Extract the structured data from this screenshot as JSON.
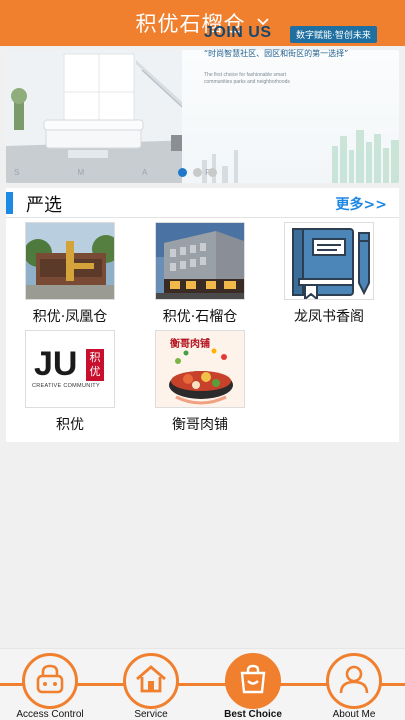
{
  "header": {
    "title": "积优石榴仓"
  },
  "banner": {
    "join_title": "JOIN US",
    "tag": "数字赋能·智创未来",
    "slogan": "“时尚智慧社区、园区和街区的第一选择”",
    "english": "The first choice for fashionable smart communities parks and neighborhoods",
    "watermark": "S M A R",
    "page_count": 3,
    "active_page": 1
  },
  "section": {
    "title": "严选",
    "more": "更多>>",
    "items": [
      {
        "label": "积优·凤凰仓",
        "icon": "building-photo"
      },
      {
        "label": "积优·石榴仓",
        "icon": "building-photo"
      },
      {
        "label": "龙凤书香阁",
        "icon": "book-icon"
      },
      {
        "label": "积优",
        "icon": "ju-logo",
        "logo_text": "JU",
        "logo_sub": "积优",
        "logo_caption": "CREATIVE COMMUNITY"
      },
      {
        "label": "衡哥肉铺",
        "icon": "meat-photo",
        "photo_text": "衡哥肉铺"
      }
    ]
  },
  "nav": {
    "items": [
      {
        "label": "Access Control",
        "icon": "lock-icon",
        "active": false
      },
      {
        "label": "Service",
        "icon": "home-icon",
        "active": false
      },
      {
        "label": "Best Choice",
        "icon": "bag-icon",
        "active": true
      },
      {
        "label": "About Me",
        "icon": "user-icon",
        "active": false
      }
    ]
  },
  "colors": {
    "brand": "#f07f2e",
    "accent": "#1e88e5"
  }
}
